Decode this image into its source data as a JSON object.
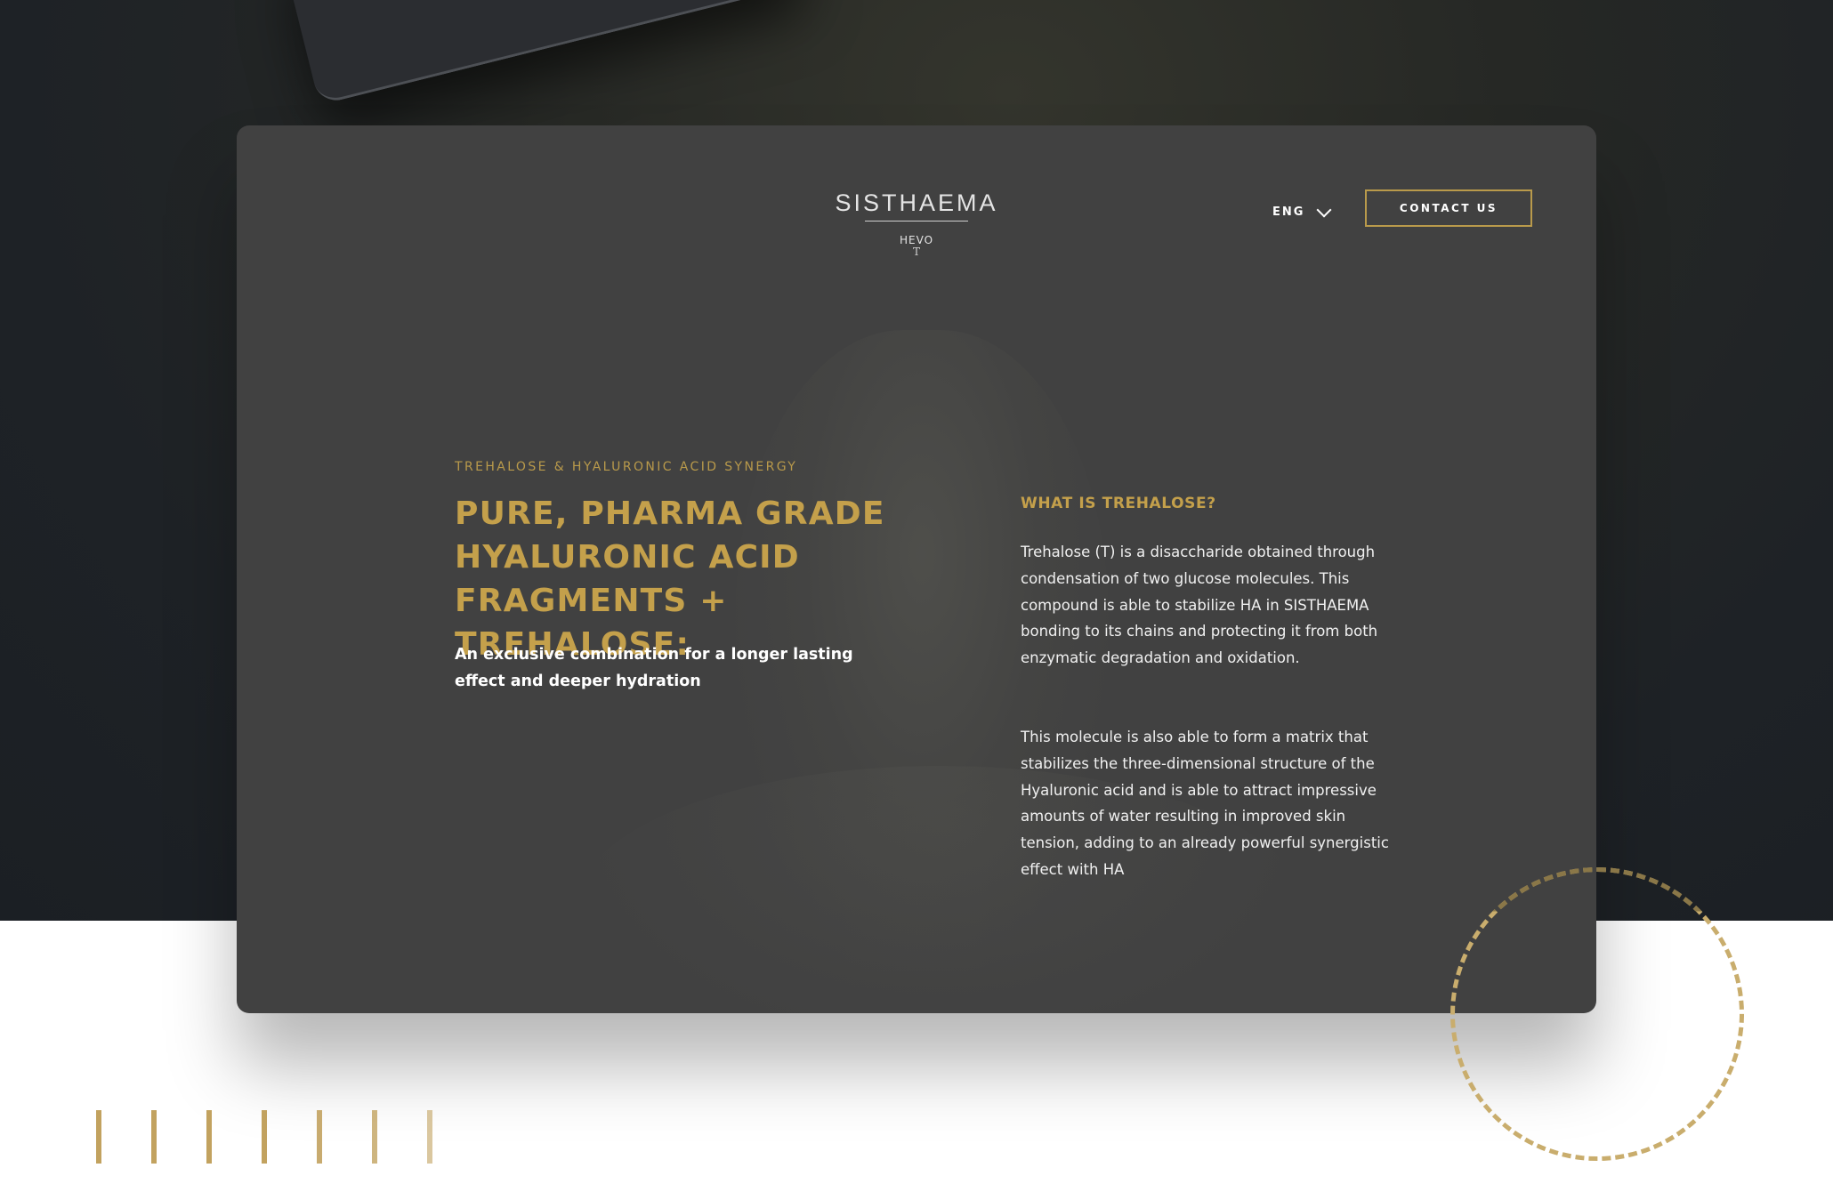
{
  "brand": {
    "logo_text": "SISTHAEMA",
    "logo_subtext": "HEVO",
    "logo_mark": "T"
  },
  "header": {
    "language_label": "ENG",
    "language_icon": "chevron-down-icon",
    "contact_label": "CONTACT US"
  },
  "hero": {
    "eyebrow": "TREHALOSE & HYALURONIC ACID SYNERGY",
    "headline": "PURE, PHARMA GRADE HYALURONIC ACID FRAGMENTS + TREHALOSE:",
    "lead": "An exclusive combination for a longer lasting effect and deeper hydration"
  },
  "info": {
    "question": "WHAT IS TREHALOSE?",
    "paragraph_1": "Trehalose (T) is a disaccharide obtained through condensation of two glucose molecules. This compound is able to stabilize HA in SISTHAEMA bonding to its chains and protecting it from both enzymatic degradation and oxidation.",
    "paragraph_2": "This molecule is also able to form a matrix that stabilizes the three-dimensional structure of the Hyaluronic acid and is able to attract impressive amounts of water resulting in improved skin tension, adding to an already powerful synergistic effect with HA"
  },
  "colors": {
    "accent_gold": "#c4a04b",
    "card_bg": "#414141",
    "page_dark": "#1e2226"
  }
}
